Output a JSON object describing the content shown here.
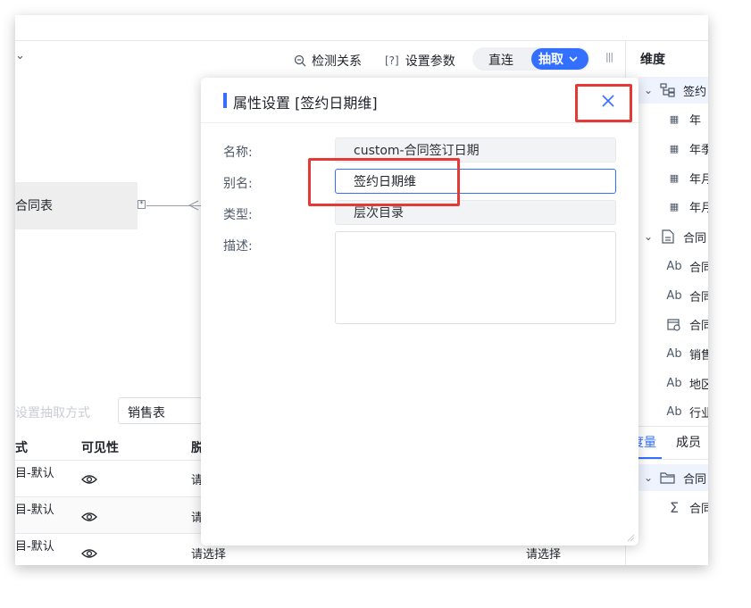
{
  "toolbar": {
    "chevron": "⌄",
    "detect_relation": "检测关系",
    "set_params": "设置参数",
    "mode_direct": "直连",
    "mode_extract": "抽取",
    "more": "|||"
  },
  "canvas": {
    "table_node_label": "合同表",
    "star": "*"
  },
  "bottom": {
    "extract_hint": "设置抽取方式",
    "table_select_value": "销售表",
    "columns": [
      "式",
      "可见性",
      "脱"
    ],
    "rows": [
      {
        "mode": "目-默认",
        "select": "请"
      },
      {
        "mode": "目-默认",
        "select": "请"
      },
      {
        "mode": "目-默认",
        "select": "请选择",
        "select2": "请选择"
      }
    ]
  },
  "right_panel": {
    "title": "维度",
    "items": [
      {
        "label": "签约",
        "icon": "hierarchy-icon",
        "expandable": true
      },
      {
        "label": "年",
        "icon": "date-icon"
      },
      {
        "label": "年季",
        "icon": "date-icon"
      },
      {
        "label": "年月",
        "icon": "date-icon"
      },
      {
        "label": "年月",
        "icon": "date-icon"
      },
      {
        "label": "合同",
        "icon": "table-icon",
        "expandable": true
      },
      {
        "label": "合同",
        "icon": "text-icon"
      },
      {
        "label": "合同",
        "icon": "text-icon"
      },
      {
        "label": "合同",
        "icon": "calendar-icon"
      },
      {
        "label": "销售",
        "icon": "text-icon"
      },
      {
        "label": "地区",
        "icon": "text-icon"
      },
      {
        "label": "行业",
        "icon": "text-icon"
      }
    ],
    "tabs": [
      "度量",
      "成员"
    ],
    "measure_items": [
      {
        "label": "合同",
        "icon": "folder-icon",
        "expandable": true
      },
      {
        "label": "合同",
        "icon": "sum-icon"
      }
    ],
    "text_glyph": "Ab",
    "sum_glyph": "Σ"
  },
  "modal": {
    "title": "属性设置 [签约日期维]",
    "labels": {
      "name": "名称:",
      "alias": "别名:",
      "type": "类型:",
      "desc": "描述:"
    },
    "values": {
      "name": "custom-合同签订日期",
      "alias": "签约日期维",
      "type": "层次目录",
      "desc": ""
    },
    "close_glyph": "×"
  },
  "colors": {
    "accent": "#3370ff",
    "highlight": "#e53935"
  }
}
